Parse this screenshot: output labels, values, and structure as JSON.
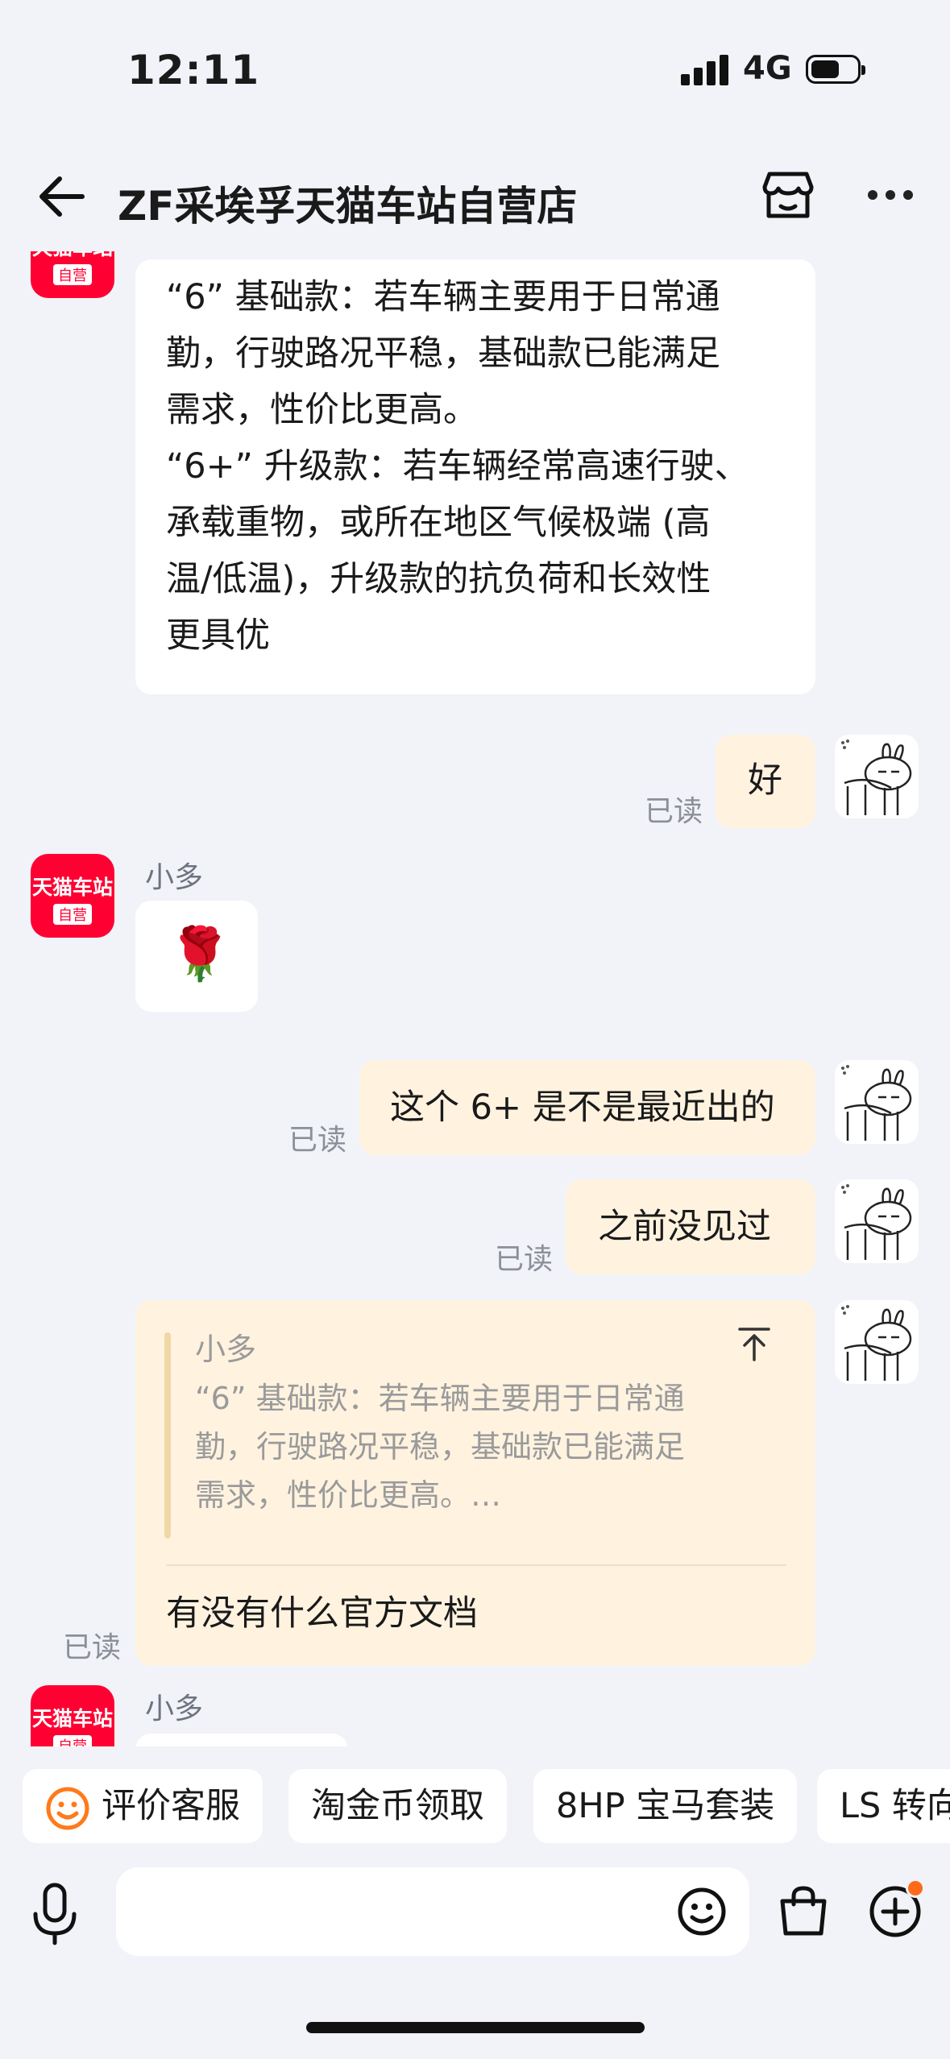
{
  "status_bar": {
    "time": "12:11",
    "network": "4G"
  },
  "header": {
    "title": "ZF采埃孚天猫车站自营店"
  },
  "avatars": {
    "shop": {
      "line1": "天猫车站",
      "line2": "自营"
    }
  },
  "messages": {
    "m1": {
      "lines": [
        "“6” 基础款：若车辆主要用于日常通",
        "勤，行驶路况平稳，基础款已能满足",
        "需求，性价比更高。",
        "“6+” 升级款：若车辆经常高速行驶、",
        "承载重物，或所在地区气候极端 (高",
        "温/低温)，升级款的抗负荷和长效性",
        "更具优"
      ]
    },
    "m2": {
      "text": "好",
      "status": "已读"
    },
    "m3": {
      "sender": "小多",
      "emoji": "🌹"
    },
    "m4": {
      "text": "这个 6+ 是不是最近出的",
      "status": "已读"
    },
    "m5": {
      "text": "之前没见过",
      "status": "已读"
    },
    "m6": {
      "quote_sender": "小多",
      "quote_lines": [
        "“6” 基础款：若车辆主要用于日常通",
        "勤，行驶路况平稳，基础款已能满足",
        "需求，性价比更高。…"
      ],
      "text": "有没有什么官方文档",
      "status": "已读"
    },
    "m7": {
      "sender": "小多"
    }
  },
  "quick_replies": [
    "评价客服",
    "淘金币领取",
    "8HP 宝马套装",
    "LS 转向"
  ],
  "input": {
    "placeholder": ""
  },
  "colors": {
    "shop_red": "#ff0033",
    "my_bubble": "#fff3e0",
    "notify_dot": "#ff6a1a"
  }
}
